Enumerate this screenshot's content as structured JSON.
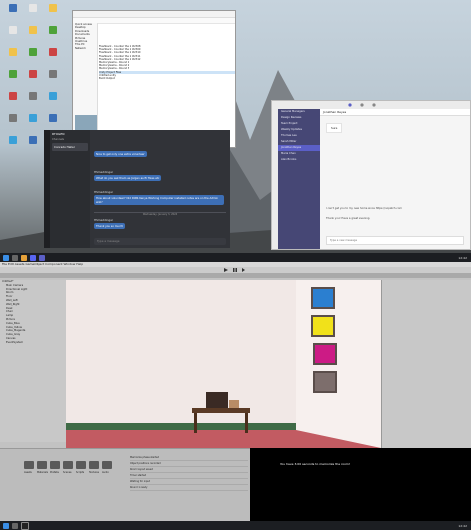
{
  "file_manager": {
    "title": "",
    "sidebar": [
      "Quick access",
      "Desktop",
      "Downloads",
      "Documents",
      "Pictures",
      "OneDrive",
      "This PC",
      "Network"
    ],
    "rows": [
      "Flashback - Counter the 1 #2308",
      "Flashback - Counter the 1 #2309",
      "Flashback - Counter the 1 #2310",
      "Flashback - Counter the 1 #2311",
      "Flashback - Counter the 1 #2312",
      "MemoryGame - Round 1",
      "MemoryGame - Round 2",
      "MemoryGame - Round 3",
      "Unity Project Files",
      "Untitled.unity",
      "Build Output"
    ]
  },
  "chat": {
    "server_label": "RTOGEN",
    "channel_label": "Channels",
    "dm_name": "Conrado Haller",
    "messages": [
      {
        "author": "",
        "text": "Nice to get only one extra volunteer"
      },
      {
        "author": "HSmeddinger",
        "text": "What do you ask them as Jorgen as fir fixes etc"
      },
      {
        "author": "HSmeddinger",
        "text": "How about volunteer? Did DiNS Kenya Working Computer installed notes are on the Admin wiki?"
      },
      {
        "author": "HSmeddinger",
        "text": "Thank you so much!"
      }
    ],
    "day_sep": "Wednesday, January 3, 2024",
    "input_placeholder": "Type a message"
  },
  "teams": {
    "title": "",
    "chat_list": [
      "General Managers",
      "Design Reviews",
      "Team Project",
      "Weekly Updates",
      "Thomas Lee",
      "Sarah Miller",
      "Jonathan Reyes",
      "Maria Chen",
      "Alan Brooks"
    ],
    "active_index": 6,
    "header_name": "Jonathan Reyes",
    "messages": [
      {
        "text": "Sure"
      },
      {
        "text": "I can't get you to my new home since https://nopatch.com"
      },
      {
        "text": "Thank you! Have a great evening."
      }
    ],
    "input_placeholder": "Type a new message"
  },
  "unity": {
    "menu": "File  Edit  Assets  GameObject  Component  Window  Help",
    "hierarchy": [
      "Untitled*",
      "Main Camera",
      "Directional Light",
      "Room",
      "Floor",
      "Wall_Left",
      "Wall_Right",
      "Desk",
      "Chair",
      "Lamp",
      "Picture",
      "Cube_Blue",
      "Cube_Yellow",
      "Cube_Magenta",
      "Cube_Gray",
      "Canvas",
      "EventSystem"
    ],
    "project_folders": [
      "Assets",
      "Materials",
      "Prefabs",
      "Scenes",
      "Scripts",
      "Textures",
      "Audio"
    ],
    "game_text": "You have 3.00 seconds to memorize the room!",
    "console_lines": [
      "Memorize phase started",
      "Object positions recorded",
      "Room layout saved",
      "Timer started",
      "Waiting for input",
      "Round 1 ready"
    ]
  },
  "taskbar": {
    "clock": "12:42"
  },
  "colors": {
    "cube_blue": "#2b7fd0",
    "cube_yellow": "#f1e11a",
    "cube_magenta": "#cc1b85",
    "cube_gray": "#7d6e6c",
    "carpet": "#c25b62",
    "unity_bg": "#c2c2c2"
  }
}
